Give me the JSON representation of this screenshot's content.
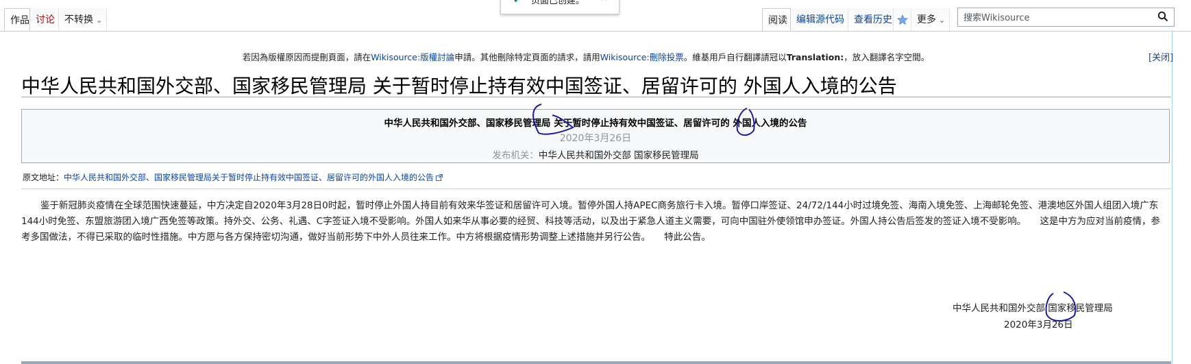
{
  "tabs_left": [
    {
      "label": "作品",
      "active": true
    },
    {
      "label": "讨论",
      "active": false
    },
    {
      "label": "不转换",
      "active": false,
      "dropdown": true
    }
  ],
  "tabs_right": [
    {
      "label": "阅读",
      "active": true
    },
    {
      "label": "编辑源代码",
      "active": false
    },
    {
      "label": "查看历史",
      "active": false
    },
    {
      "label": "更多",
      "active": false,
      "dropdown": true
    }
  ],
  "notification": {
    "text": "页面已创建。",
    "close": "×"
  },
  "search": {
    "placeholder": "搜索Wikisource"
  },
  "sitenotice": {
    "pre": "若因為版權原因而提刪頁面，請在",
    "link1": "Wikisource:版權討論",
    "mid1": "申請。其他刪除特定頁面的請求，請用",
    "link2": "Wikisource:刪除投票",
    "mid2": "。維基用戶自行翻譯請冠以",
    "bold": "Translation:",
    "post": "，放入翻譯名字空間。",
    "close": "[关闭]"
  },
  "page_title": "中华人民共和国外交部、国家移民管理局 关于暂时停止持有效中国签证、居留许可的 外国人入境的公告",
  "header": {
    "title": "中华人民共和国外交部、国家移民管理局 关于暂时停止持有效中国签证、居留许可的 外国人入境的公告",
    "date": "2020年3月26日",
    "issuer_label": "发布机关：",
    "issuer": "中华人民共和国外交部 国家移民管理局"
  },
  "source": {
    "label": "原文地址：",
    "link": "中华人民共和国外交部、国家移民管理局关于暂时停止持有效中国签证、居留许可的外国人入境的公告"
  },
  "body": "鉴于新冠肺炎疫情在全球范围快速蔓延，中方决定自2020年3月28日0时起，暂时停止外国人持目前有效来华签证和居留许可入境。暂停外国人持APEC商务旅行卡入境。暂停口岸签证、24/72/144小时过境免签、海南入境免签、上海邮轮免签、港澳地区外国人组团入境广东144小时免签、东盟旅游团入境广西免签等政策。持外交、公务、礼遇、C字签证入境不受影响。外国人如来华从事必要的经贸、科技等活动，以及出于紧急人道主义需要，可向中国驻外使领馆申办签证。外国人持公告后签发的签证入境不受影响。　　这是中方为应对当前疫情，参考多国做法，不得已采取的临时性措施。中方愿与各方保持密切沟通，做好当前形势下中外人员往来工作。中方将根据疫情形势调整上述措施并另行公告。　　特此公告。",
  "signature": {
    "issuer": "中华人民共和国外交部 国家移民管理局",
    "date": "2020年3月26日"
  },
  "colors": {
    "link": "#0645ad",
    "tab_border": "#a7d7f9",
    "annotation_pen": "#1a1aa6"
  }
}
